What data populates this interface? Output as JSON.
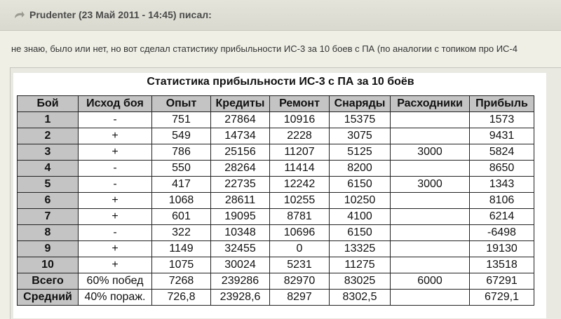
{
  "post": {
    "author_line": "Prudenter (23 Май 2011 - 14:45) писал:",
    "text": "не знаю, было или нет, но вот сделал статистику прибыльности ИС-3 за 10 боев с ПА (по аналогии с топиком про ИС-4",
    "quote_icon": "quote-arrow-icon"
  },
  "table": {
    "title": "Статистика прибыльности ИС-3 с ПА за 10 боёв",
    "headers": [
      "Бой",
      "Исход боя",
      "Опыт",
      "Кредиты",
      "Ремонт",
      "Снаряды",
      "Расходники",
      "Прибыль"
    ],
    "rows": [
      [
        "1",
        "-",
        "751",
        "27864",
        "10916",
        "15375",
        "",
        "1573"
      ],
      [
        "2",
        "+",
        "549",
        "14734",
        "2228",
        "3075",
        "",
        "9431"
      ],
      [
        "3",
        "+",
        "786",
        "25156",
        "11207",
        "5125",
        "3000",
        "5824"
      ],
      [
        "4",
        "-",
        "550",
        "28264",
        "11414",
        "8200",
        "",
        "8650"
      ],
      [
        "5",
        "-",
        "417",
        "22735",
        "12242",
        "6150",
        "3000",
        "1343"
      ],
      [
        "6",
        "+",
        "1068",
        "28611",
        "10255",
        "10250",
        "",
        "8106"
      ],
      [
        "7",
        "+",
        "601",
        "19095",
        "8781",
        "4100",
        "",
        "6214"
      ],
      [
        "8",
        "-",
        "322",
        "10348",
        "10696",
        "6150",
        "",
        "-6498"
      ],
      [
        "9",
        "+",
        "1149",
        "32455",
        "0",
        "13325",
        "",
        "19130"
      ],
      [
        "10",
        "+",
        "1075",
        "30024",
        "5231",
        "11275",
        "",
        "13518"
      ],
      [
        "Всего",
        "60% побед",
        "7268",
        "239286",
        "82970",
        "83025",
        "6000",
        "67291"
      ],
      [
        "Средний",
        "40% пораж.",
        "726,8",
        "23928,6",
        "8297",
        "8302,5",
        "",
        "6729,1"
      ]
    ]
  },
  "colors": {
    "header_bg": "#c4c4c4",
    "page_bg": "#efefe6",
    "quote_bar": "#d9d9cf"
  }
}
